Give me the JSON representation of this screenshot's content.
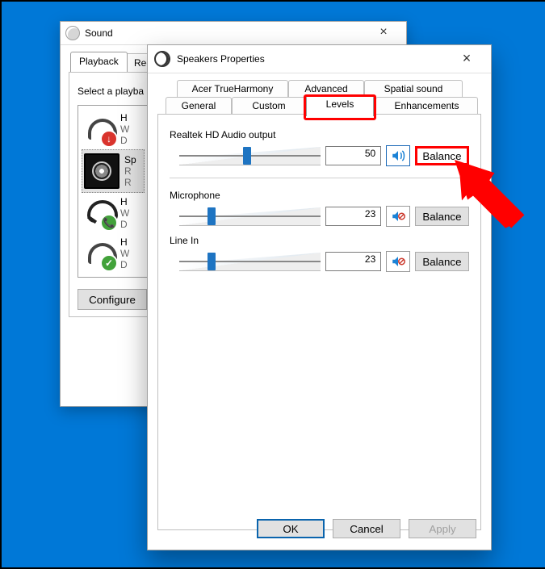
{
  "sound_win": {
    "title": "Sound",
    "tabs": {
      "playback": "Playback",
      "recording": "Recor"
    },
    "instruction": "Select a playba",
    "devices": [
      {
        "line1": "H",
        "line2": "W",
        "line3": "D"
      },
      {
        "line1": "Sp",
        "line2": "R",
        "line3": "R"
      },
      {
        "line1": "H",
        "line2": "W",
        "line3": "D"
      },
      {
        "line1": "H",
        "line2": "W",
        "line3": "D"
      }
    ],
    "configure": "Configure"
  },
  "props_win": {
    "title": "Speakers Properties",
    "tabs": {
      "row1": [
        "Acer TrueHarmony",
        "Advanced",
        "Spatial sound"
      ],
      "row2": [
        "General",
        "Custom",
        "Levels",
        "Enhancements"
      ]
    },
    "controls": [
      {
        "label": "Realtek HD Audio output",
        "value": "50",
        "pos": 48,
        "muted": false
      },
      {
        "label": "Microphone",
        "value": "23",
        "pos": 23,
        "muted": true
      },
      {
        "label": "Line In",
        "value": "23",
        "pos": 23,
        "muted": true
      }
    ],
    "balance": "Balance",
    "buttons": {
      "ok": "OK",
      "cancel": "Cancel",
      "apply": "Apply"
    }
  }
}
